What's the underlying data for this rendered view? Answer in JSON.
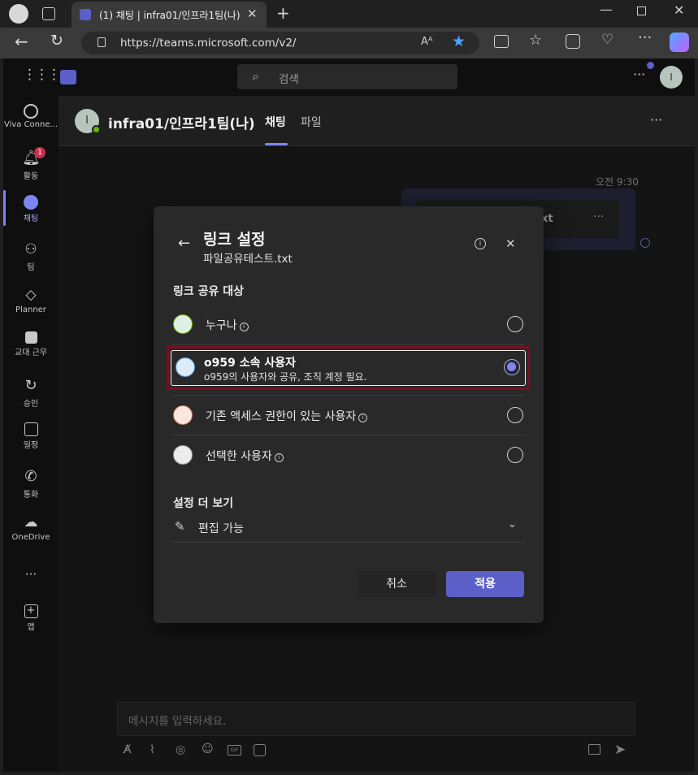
{
  "browser": {
    "tab_title": "(1) 채팅 | infra01/인프라1팀(나) |",
    "url": "https://teams.microsoft.com/v2/"
  },
  "teams": {
    "search_placeholder": "검색",
    "rail": [
      {
        "label": "Viva Conne..."
      },
      {
        "label": "활동",
        "badge": "1"
      },
      {
        "label": "채팅"
      },
      {
        "label": "팀"
      },
      {
        "label": "Planner"
      },
      {
        "label": "교대 근무"
      },
      {
        "label": "승인"
      },
      {
        "label": "일정"
      },
      {
        "label": "통화"
      },
      {
        "label": "OneDrive"
      },
      {
        "label": "앱"
      }
    ]
  },
  "chat": {
    "avatar_initial": "I",
    "title": "infra01/인프라1팀(나)",
    "tabs": [
      "채팅",
      "파일"
    ],
    "timestamp": "오전 9:30",
    "file_suffix": "xt",
    "compose_placeholder": "메시지를 입력하세요."
  },
  "dialog": {
    "title": "링크 설정",
    "file_name": "파일공유테스트.txt",
    "share_section": "링크 공유 대상",
    "options": [
      {
        "label": "누구나"
      },
      {
        "label": "o959 소속 사용자",
        "sub": "o959의 사용자와 공유, 조직 계정 필요."
      },
      {
        "label": "기존 액세스 권한이 있는 사용자"
      },
      {
        "label": "선택한 사용자"
      }
    ],
    "more_section": "설정 더 보기",
    "permission": "편집 가능",
    "cancel": "취소",
    "apply": "적용"
  },
  "colors": {
    "accent": "#5b5fc7",
    "highlight": "#7a0f22"
  }
}
